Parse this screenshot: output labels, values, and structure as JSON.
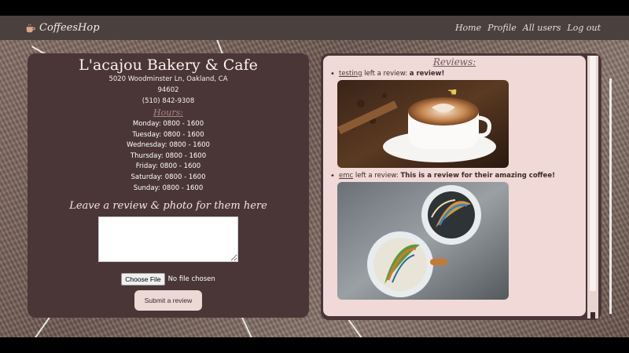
{
  "navbar": {
    "brand": "CoffeesHop",
    "links": [
      "Home",
      "Profile",
      "All users",
      "Log out"
    ]
  },
  "cafe": {
    "name": "L'acajou Bakery & Cafe",
    "address_line1": "5020 Woodminster Ln, Oakland, CA",
    "address_line2": "94602",
    "phone": "(510) 842-9308",
    "hours_title": "Hours:",
    "hours": [
      "Monday: 0800 - 1600",
      "Tuesday: 0800 - 1600",
      "Wednesday: 0800 - 1600",
      "Thursday: 0800 - 1600",
      "Friday: 0800 - 1600",
      "Saturday: 0800 - 1600",
      "Sunday: 0800 - 1600"
    ]
  },
  "review_form": {
    "heading": "Leave a review & photo for them here",
    "choose_file": "Choose File",
    "file_status": "No file chosen",
    "submit": "Submit a review"
  },
  "reviews": {
    "title": "Reviews:",
    "items": [
      {
        "user": "testing",
        "middle": " left a review: ",
        "text": "a review!",
        "photo": "latte-cup-photo"
      },
      {
        "user": "emc",
        "middle": " left a review: ",
        "text": "This is a review for their amazing coffee!",
        "photo": "colorful-latte-art-photo"
      }
    ]
  },
  "colors": {
    "navbar_bg": "#4a403e",
    "panel_bg": "#4a3637",
    "reviews_bg": "#f0d9d6",
    "hours_title": "#a98880",
    "submit_bg": "#ecd8d4"
  }
}
